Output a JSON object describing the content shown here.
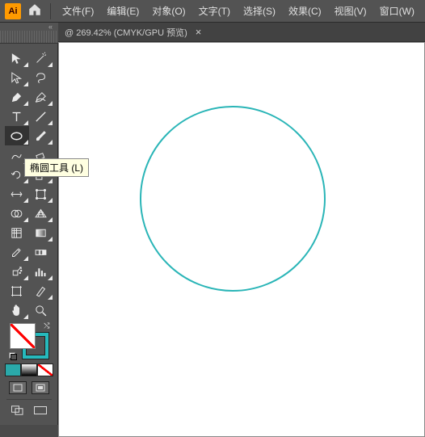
{
  "app": {
    "logo_text": "Ai"
  },
  "menu": {
    "file": "文件(F)",
    "edit": "编辑(E)",
    "object": "对象(O)",
    "type": "文字(T)",
    "select": "选择(S)",
    "effect": "效果(C)",
    "view": "视图(V)",
    "window": "窗口(W)"
  },
  "tab": {
    "title": "@ 269.42% (CMYK/GPU 预览)",
    "close": "×"
  },
  "handle": {
    "collapse": "«"
  },
  "tooltip": {
    "ellipse": "椭圆工具 (L)"
  },
  "colors": {
    "stroke": "#26b9bc"
  },
  "canvas_shape": {
    "type": "ellipse",
    "stroke": "#2ab5b7"
  }
}
